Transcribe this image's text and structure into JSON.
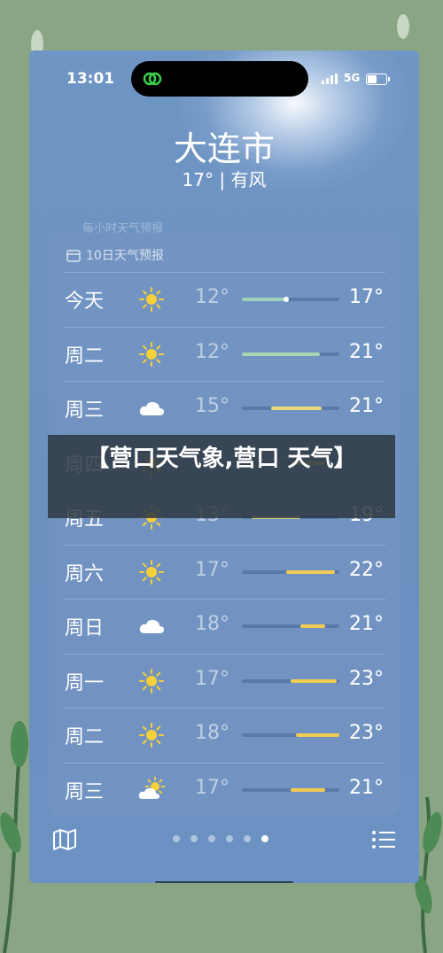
{
  "status": {
    "time": "13:01",
    "network": "5G"
  },
  "location": {
    "city": "大连市",
    "summary": "17° | 有风"
  },
  "hourly_ghost": "每小时天气预报",
  "forecast": {
    "title": "10日天气预报",
    "rows": [
      {
        "day": "今天",
        "icon": "sun-icon",
        "low": "12°",
        "high": "17°",
        "bar_start": 0.0,
        "bar_end": 0.45,
        "bar_color": "#9fd0b8",
        "current_dot": 0.45
      },
      {
        "day": "周二",
        "icon": "sun-icon",
        "low": "12°",
        "high": "21°",
        "bar_start": 0.0,
        "bar_end": 0.8,
        "bar_color": "#a7d6b0"
      },
      {
        "day": "周三",
        "icon": "cloud-icon",
        "low": "15°",
        "high": "21°",
        "bar_start": 0.3,
        "bar_end": 0.82,
        "bar_color": "#e6da7a"
      },
      {
        "day": "周四",
        "icon": "sun-icon",
        "low": "",
        "high": "",
        "bar_start": 0.5,
        "bar_end": 0.85,
        "bar_color": "#e8d468"
      },
      {
        "day": "周五",
        "icon": "sun-icon",
        "low": "13°",
        "high": "19°",
        "bar_start": 0.1,
        "bar_end": 0.6,
        "bar_color": "#d8d48a"
      },
      {
        "day": "周六",
        "icon": "sun-icon",
        "low": "17°",
        "high": "22°",
        "bar_start": 0.45,
        "bar_end": 0.95,
        "bar_color": "#f0cc52"
      },
      {
        "day": "周日",
        "icon": "cloud-icon",
        "low": "18°",
        "high": "21°",
        "bar_start": 0.6,
        "bar_end": 0.85,
        "bar_color": "#f0cc52"
      },
      {
        "day": "周一",
        "icon": "sun-icon",
        "low": "17°",
        "high": "23°",
        "bar_start": 0.5,
        "bar_end": 0.97,
        "bar_color": "#f0cc52"
      },
      {
        "day": "周二",
        "icon": "sun-icon",
        "low": "18°",
        "high": "23°",
        "bar_start": 0.55,
        "bar_end": 1.0,
        "bar_color": "#f0cc52"
      },
      {
        "day": "周三",
        "icon": "partly-cloudy-icon",
        "low": "17°",
        "high": "21°",
        "bar_start": 0.5,
        "bar_end": 0.85,
        "bar_color": "#f0cc52"
      }
    ]
  },
  "overlay_banner": "【营口天气象,营口 天气】",
  "bottom_bar": {
    "page_count": 6,
    "active_page": 6
  }
}
